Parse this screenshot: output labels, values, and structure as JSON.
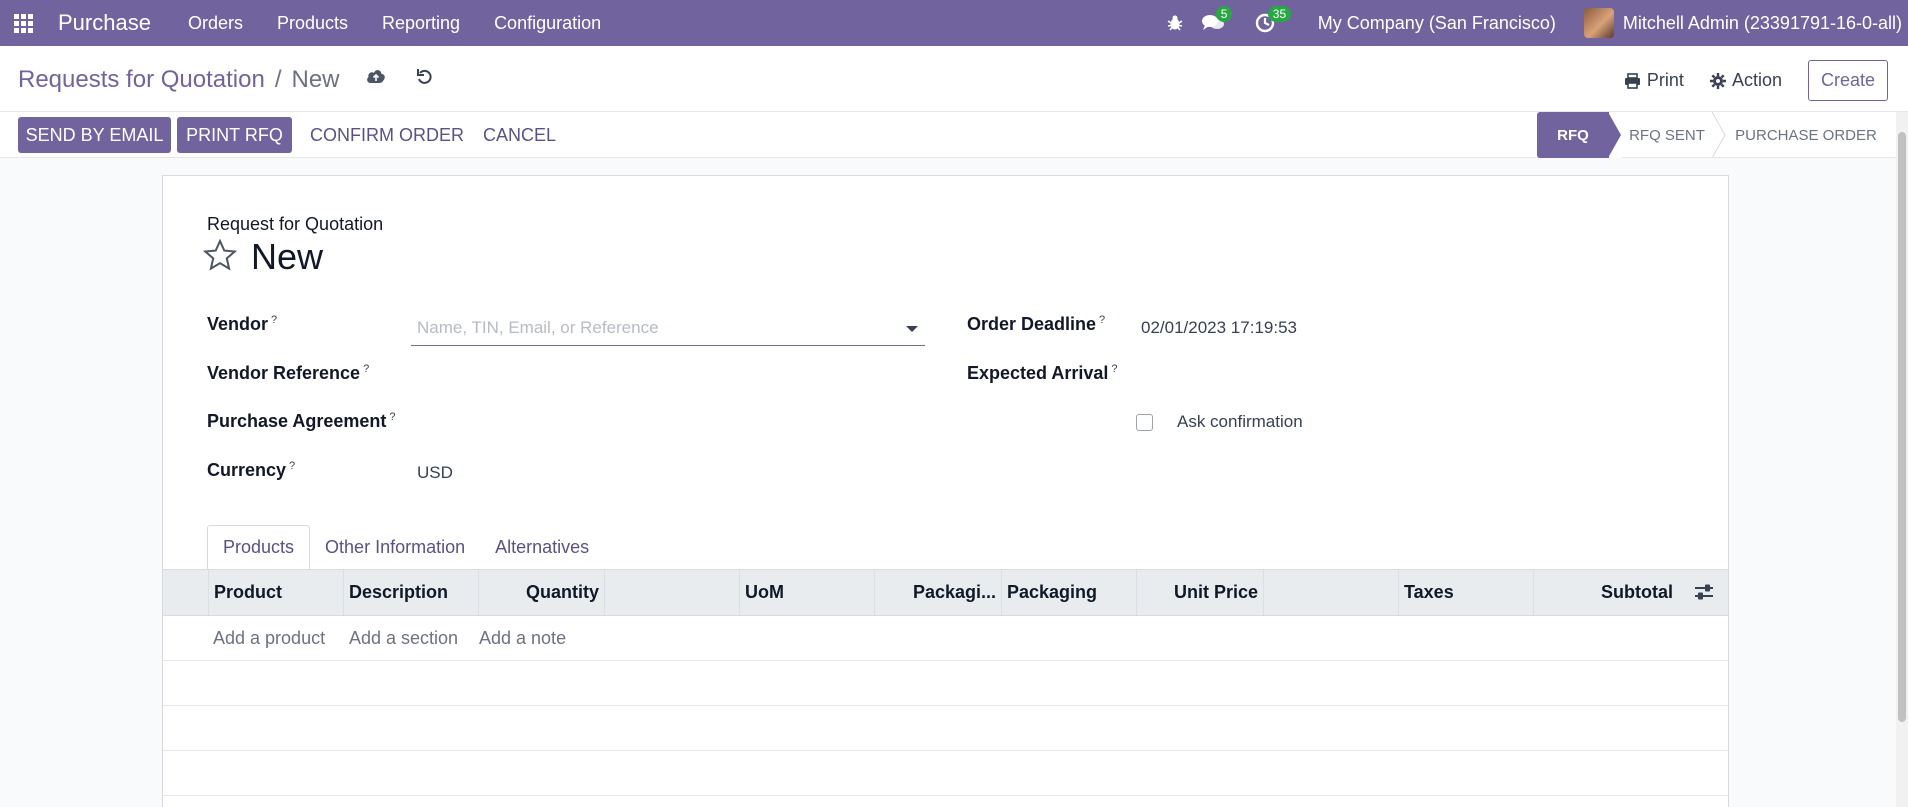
{
  "navbar": {
    "app_name": "Purchase",
    "menu": [
      "Orders",
      "Products",
      "Reporting",
      "Configuration"
    ],
    "messages_count": "5",
    "activities_count": "35",
    "company": "My Company (San Francisco)",
    "user": "Mitchell Admin (23391791-16-0-all)"
  },
  "control_panel": {
    "breadcrumb_parent": "Requests for Quotation",
    "breadcrumb_sep": "/",
    "breadcrumb_current": "New",
    "print_label": "Print",
    "action_label": "Action",
    "create_label": "Create"
  },
  "statusbar": {
    "send_email_label": "SEND BY EMAIL",
    "print_rfq_label": "PRINT RFQ",
    "confirm_label": "CONFIRM ORDER",
    "cancel_label": "CANCEL",
    "stages": [
      "RFQ",
      "RFQ SENT",
      "PURCHASE ORDER"
    ],
    "active_stage": "RFQ"
  },
  "form": {
    "title_label": "Request for Quotation",
    "title": "New",
    "vendor_label": "Vendor",
    "vendor_placeholder": "Name, TIN, Email, or Reference",
    "vendor_reference_label": "Vendor Reference",
    "purchase_agreement_label": "Purchase Agreement",
    "currency_label": "Currency",
    "currency_value": "USD",
    "order_deadline_label": "Order Deadline",
    "order_deadline_value": "02/01/2023 17:19:53",
    "expected_arrival_label": "Expected Arrival",
    "ask_confirmation_label": "Ask confirmation",
    "help_mark": "?"
  },
  "tabs": [
    "Products",
    "Other Information",
    "Alternatives"
  ],
  "table": {
    "columns": [
      "Product",
      "Description",
      "Quantity",
      "UoM",
      "Packagi...",
      "Packaging",
      "Unit Price",
      "Taxes",
      "Subtotal"
    ],
    "add_product": "Add a product",
    "add_section": "Add a section",
    "add_note": "Add a note"
  },
  "colors": {
    "brand": "#71639e",
    "badge": "#28a745"
  }
}
